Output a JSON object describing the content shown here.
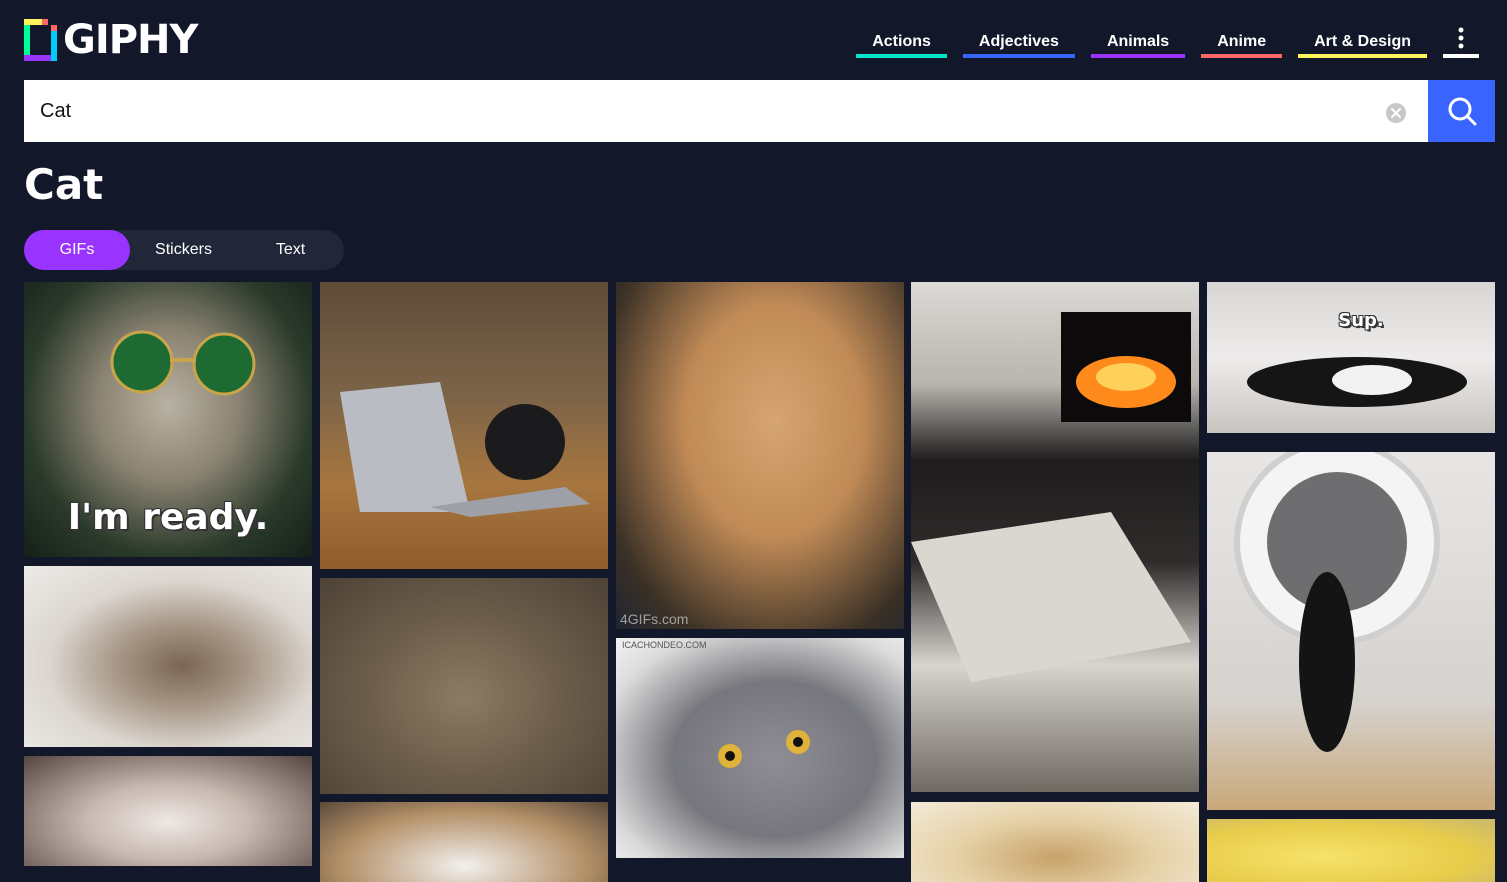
{
  "header": {
    "logo_text": "GIPHY",
    "nav": [
      {
        "label": "Actions",
        "color": "#ffffff"
      },
      {
        "label": "Adjectives",
        "color": "#ffffff"
      },
      {
        "label": "Animals",
        "color": "#ffffff"
      },
      {
        "label": "Anime",
        "color": "#ffffff"
      },
      {
        "label": "Art & Design",
        "color": "#ffffff"
      }
    ]
  },
  "search": {
    "value": "Cat",
    "clear_icon": "close-circle-icon",
    "button_icon": "search-icon"
  },
  "page_title": "Cat",
  "tabs": [
    {
      "label": "GIFs",
      "active": true
    },
    {
      "label": "Stickers",
      "active": false
    },
    {
      "label": "Text",
      "active": false
    }
  ],
  "gifs": [
    {
      "caption": "I'm ready."
    },
    {
      "caption": ""
    },
    {
      "caption": "",
      "watermark": "4GIFs.com"
    },
    {
      "caption": ""
    },
    {
      "caption": "Sup."
    },
    {
      "caption": ""
    },
    {
      "caption": ""
    },
    {
      "caption": "",
      "watermark": "ICACHONDEO.COM"
    },
    {
      "caption": ""
    },
    {
      "caption": ""
    },
    {
      "caption": ""
    },
    {
      "caption": ""
    },
    {
      "caption": ""
    },
    {
      "caption": ""
    }
  ],
  "colors": {
    "background": "#121829",
    "search_button": "#3a64ff",
    "active_tab": "#9933ff",
    "tab_bar": "#212739"
  }
}
